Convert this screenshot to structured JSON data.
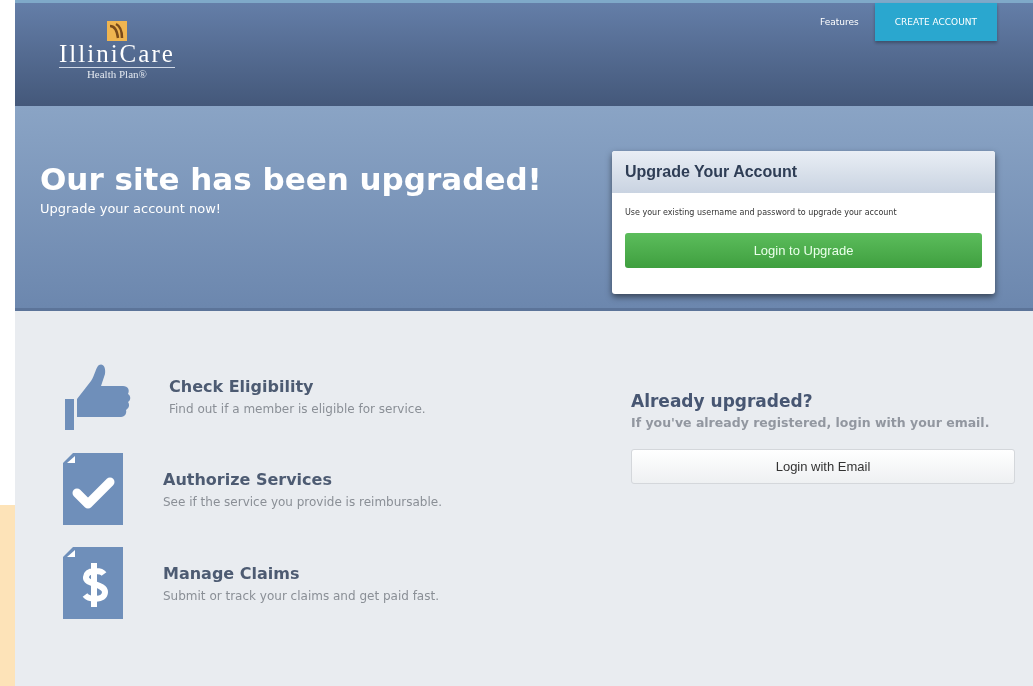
{
  "header": {
    "logo": {
      "name": "IlliniCare",
      "tagline": "Health Plan®"
    },
    "nav": [
      {
        "label": "Features",
        "kind": "link"
      },
      {
        "label": "CREATE ACCOUNT",
        "kind": "button"
      }
    ]
  },
  "hero": {
    "title": "Our site has been upgraded!",
    "subtitle": "Upgrade your account now!"
  },
  "upgrade_card": {
    "title": "Upgrade Your Account",
    "text": "Use your existing username and password to upgrade your account",
    "button": "Login to Upgrade"
  },
  "features": [
    {
      "kind": "thumb",
      "title": "Check Eligibility",
      "text": "Find out if a member is eligible for service."
    },
    {
      "kind": "check",
      "title": "Authorize Services",
      "text": "See if the service you provide is reimbursable."
    },
    {
      "kind": "dollar",
      "title": "Manage Claims",
      "text": "Submit or track your claims and get paid fast."
    }
  ],
  "already": {
    "title": "Already upgraded?",
    "text": "If you've already registered, login with your email.",
    "button": "Login with Email"
  }
}
